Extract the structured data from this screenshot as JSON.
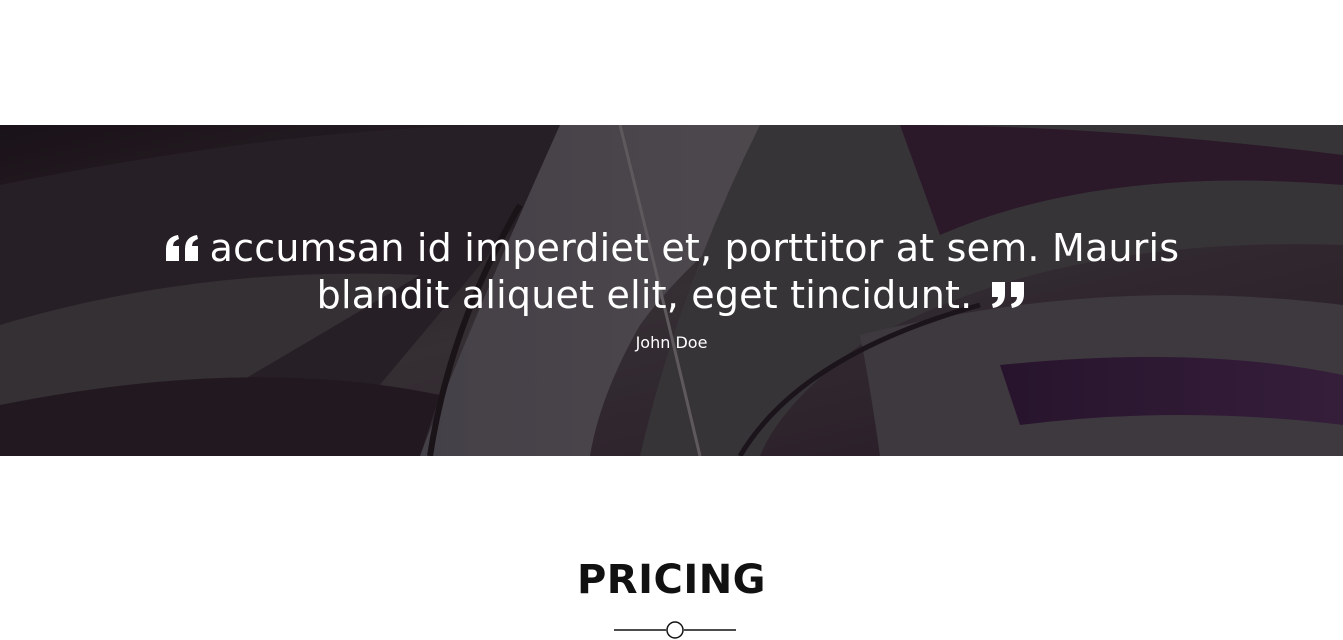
{
  "testimonial": {
    "quote": "accumsan id imperdiet et, porttitor at sem. Mauris blandit aliquet elit, eget tincidunt.",
    "author": "John Doe",
    "open_quote_icon": "quote-open-icon",
    "close_quote_icon": "quote-close-icon"
  },
  "pricing": {
    "title": "PRICING",
    "divider_icon": "circle-divider-icon"
  },
  "colors": {
    "background": "#ffffff",
    "banner_base": "#2b2230",
    "text_light": "#ffffff",
    "heading": "#111111"
  }
}
